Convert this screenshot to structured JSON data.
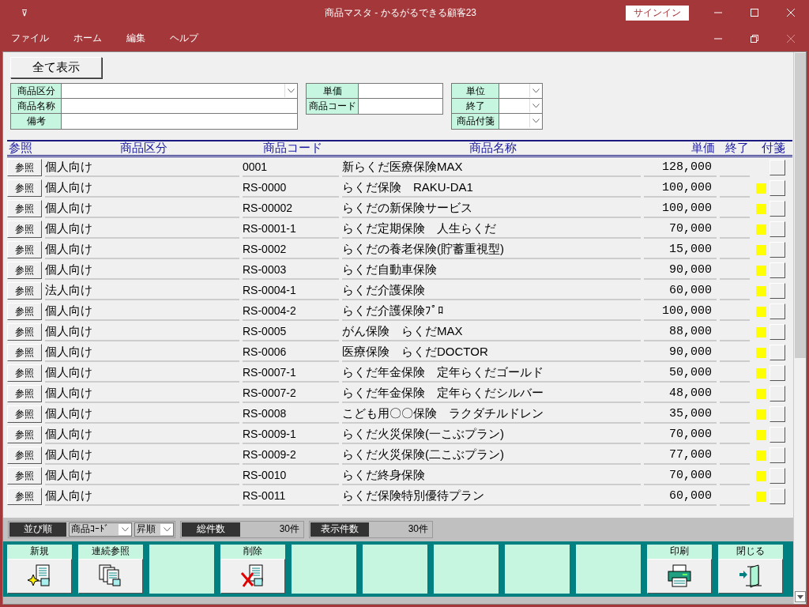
{
  "window": {
    "title": "商品マスタ  -  かるがるできる顧客23",
    "qat_glyph": "⊽",
    "signin": "サインイン"
  },
  "menu": [
    "ファイル",
    "ホーム",
    "編集",
    "ヘルプ"
  ],
  "show_all_button": "全て表示",
  "filters": {
    "left": [
      {
        "label": "商品区分",
        "kind": "combo"
      },
      {
        "label": "商品名称",
        "kind": "text"
      },
      {
        "label": "備考",
        "kind": "text"
      }
    ],
    "middle": [
      {
        "label": "単価",
        "kind": "text"
      },
      {
        "label": "商品コード",
        "kind": "text"
      }
    ],
    "right": [
      {
        "label": "単位",
        "kind": "combo"
      },
      {
        "label": "終了",
        "kind": "combo"
      },
      {
        "label": "商品付箋",
        "kind": "combo"
      }
    ]
  },
  "table": {
    "columns": [
      "参照",
      "商品区分",
      "商品コード",
      "商品名称",
      "単価",
      "終了",
      "付箋"
    ],
    "rows": [
      {
        "ref": "参照",
        "category": "個人向け",
        "code": "0001",
        "name": "新らくだ医療保険MAX",
        "price": "128,000",
        "flagged": false
      },
      {
        "ref": "参照",
        "category": "個人向け",
        "code": "RS-0000",
        "name": "らくだ保険　RAKU-DA1",
        "price": "100,000",
        "flagged": true
      },
      {
        "ref": "参照",
        "category": "個人向け",
        "code": "RS-00002",
        "name": "らくだの新保険サービス",
        "price": "100,000",
        "flagged": true
      },
      {
        "ref": "参照",
        "category": "個人向け",
        "code": "RS-0001-1",
        "name": "らくだ定期保険　人生らくだ",
        "price": "70,000",
        "flagged": true
      },
      {
        "ref": "参照",
        "category": "個人向け",
        "code": "RS-0002",
        "name": "らくだの養老保険(貯蓄重視型)",
        "price": "15,000",
        "flagged": true
      },
      {
        "ref": "参照",
        "category": "個人向け",
        "code": "RS-0003",
        "name": "らくだ自動車保険",
        "price": "90,000",
        "flagged": true
      },
      {
        "ref": "参照",
        "category": "法人向け",
        "code": "RS-0004-1",
        "name": "らくだ介護保険",
        "price": "60,000",
        "flagged": true
      },
      {
        "ref": "参照",
        "category": "個人向け",
        "code": "RS-0004-2",
        "name": "らくだ介護保険ﾌﾟﾛ",
        "price": "100,000",
        "flagged": true
      },
      {
        "ref": "参照",
        "category": "個人向け",
        "code": "RS-0005",
        "name": "がん保険　らくだMAX",
        "price": "88,000",
        "flagged": true
      },
      {
        "ref": "参照",
        "category": "個人向け",
        "code": "RS-0006",
        "name": "医療保険　らくだDOCTOR",
        "price": "90,000",
        "flagged": true
      },
      {
        "ref": "参照",
        "category": "個人向け",
        "code": "RS-0007-1",
        "name": "らくだ年金保険　定年らくだゴールド",
        "price": "50,000",
        "flagged": true
      },
      {
        "ref": "参照",
        "category": "個人向け",
        "code": "RS-0007-2",
        "name": "らくだ年金保険　定年らくだシルバー",
        "price": "48,000",
        "flagged": true
      },
      {
        "ref": "参照",
        "category": "個人向け",
        "code": "RS-0008",
        "name": "こども用〇〇保険　ラクダチルドレン",
        "price": "35,000",
        "flagged": true
      },
      {
        "ref": "参照",
        "category": "個人向け",
        "code": "RS-0009-1",
        "name": "らくだ火災保険(一こぶプラン)",
        "price": "70,000",
        "flagged": true
      },
      {
        "ref": "参照",
        "category": "個人向け",
        "code": "RS-0009-2",
        "name": "らくだ火災保険(二こぶプラン)",
        "price": "77,000",
        "flagged": true
      },
      {
        "ref": "参照",
        "category": "個人向け",
        "code": "RS-0010",
        "name": "らくだ終身保険",
        "price": "70,000",
        "flagged": true
      },
      {
        "ref": "参照",
        "category": "個人向け",
        "code": "RS-0011",
        "name": "らくだ保険特別優待プラン",
        "price": "60,000",
        "flagged": true
      }
    ]
  },
  "status": {
    "sort_label": "並び順",
    "sort_field": "商品ｺｰﾄﾞ",
    "sort_order": "昇順",
    "total_label": "総件数",
    "total": "30件",
    "shown_label": "表示件数",
    "shown": "30件"
  },
  "toolbar": [
    {
      "kind": "new",
      "label": "新規"
    },
    {
      "kind": "multi",
      "label": "連続参照"
    },
    {
      "kind": "empty"
    },
    {
      "kind": "delete",
      "label": "削除"
    },
    {
      "kind": "empty"
    },
    {
      "kind": "empty"
    },
    {
      "kind": "empty"
    },
    {
      "kind": "empty"
    },
    {
      "kind": "empty"
    },
    {
      "kind": "print",
      "label": "印刷"
    },
    {
      "kind": "close",
      "label": "閉じる"
    }
  ]
}
